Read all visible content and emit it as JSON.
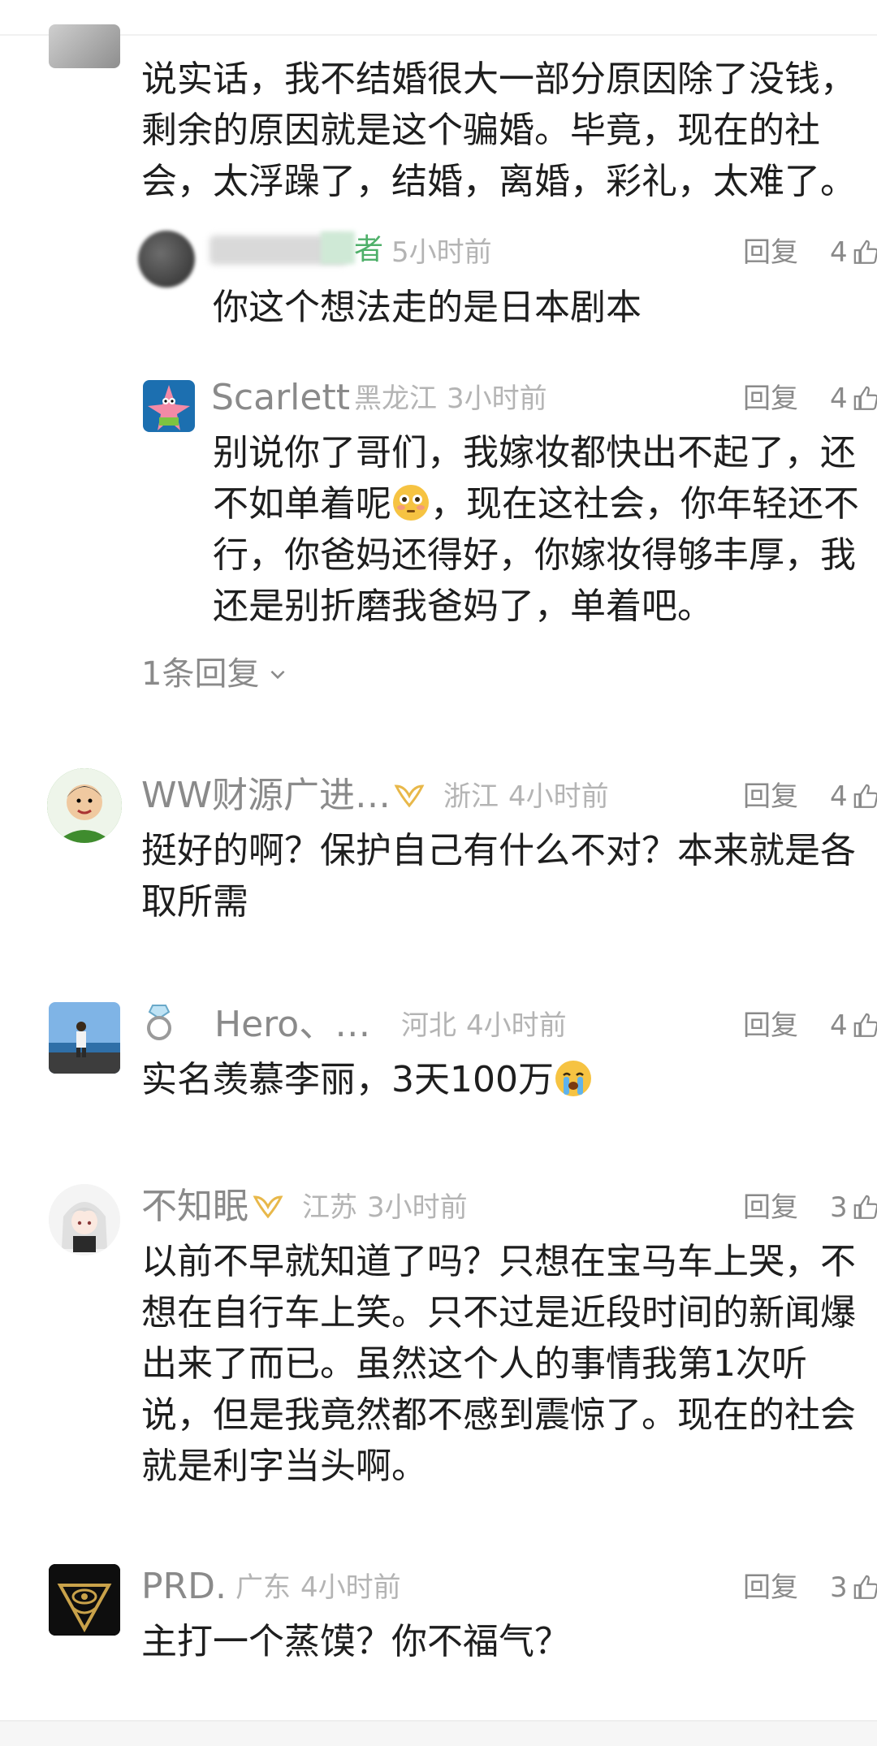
{
  "reply_label": "回复",
  "comments": [
    {
      "id": "c0",
      "body": "说实话，我不结婚很大一部分原因除了没钱，剩余的原因就是这个骗婚。毕竟，现在的社会，太浮躁了，结婚，离婚，彩礼，太难了。"
    },
    {
      "id": "r1",
      "author_suffix": "者",
      "time": "5小时前",
      "likes": "4",
      "body": "你这个想法走的是日本剧本"
    },
    {
      "id": "r2",
      "author": "Scarlett",
      "region": "黑龙江",
      "time": "3小时前",
      "likes": "4",
      "body_part1": "别说你了哥们，我嫁妆都快出不起了，还不如单着呢",
      "body_part2": "，现在这社会，你年轻还不行，你爸妈还得好，你嫁妆得够丰厚，我还是别折磨我爸妈了，单着吧。"
    },
    {
      "id": "c3",
      "author": "WW财源广进…",
      "region": "浙江",
      "time": "4小时前",
      "likes": "4",
      "body": "挺好的啊？保护自己有什么不对？本来就是各取所需"
    },
    {
      "id": "c4",
      "author": "Hero、…",
      "region": "河北",
      "time": "4小时前",
      "likes": "4",
      "body": "实名羡慕李丽，3天100万"
    },
    {
      "id": "c5",
      "author": "不知眠",
      "region": "江苏",
      "time": "3小时前",
      "likes": "3",
      "body": "以前不早就知道了吗？只想在宝马车上哭，不想在自行车上笑。只不过是近段时间的新闻爆出来了而已。虽然这个人的事情我第1次听说，但是我竟然都不感到震惊了。现在的社会就是利字当头啊。"
    },
    {
      "id": "c6",
      "author": "PRD.",
      "region": "广东",
      "time": "4小时前",
      "likes": "3",
      "body": "主打一个蒸馍？你不福气？"
    }
  ],
  "expand_replies": "1条回复",
  "colors": {
    "name": "#8a8a8a",
    "meta": "#b4b4b4",
    "body": "#1e1e1e",
    "badge_gold": "#e8b84a",
    "author_green": "#4fb06a"
  }
}
